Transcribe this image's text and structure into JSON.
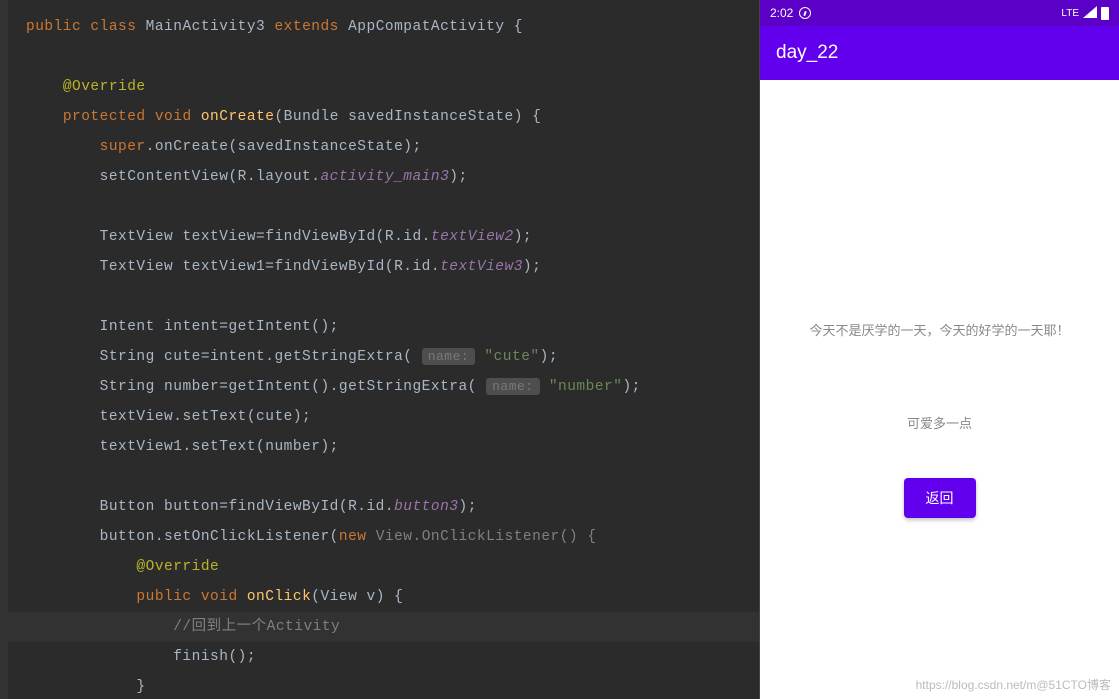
{
  "code": {
    "class_decl": {
      "public": "public",
      "class": "class",
      "name": "MainActivity3",
      "extends": "extends",
      "superclass": "AppCompatActivity",
      "open": "{"
    },
    "override1": "@Override",
    "onCreate": {
      "protected": "protected",
      "void": "void",
      "name": "onCreate",
      "params": "(Bundle savedInstanceState) {"
    },
    "superCall": {
      "super": "super",
      "rest": ".onCreate(savedInstanceState);"
    },
    "setContent": {
      "call": "setContentView(R.layout.",
      "res": "activity_main3",
      "end": ");"
    },
    "tv_decl1": {
      "type": "TextView textView=findViewById(R.id.",
      "id": "textView2",
      "end": ");"
    },
    "tv_decl2": {
      "type": "TextView textView1=findViewById(R.id.",
      "id": "textView3",
      "end": ");"
    },
    "intent": "Intent intent=getIntent();",
    "cute": {
      "pre": "String cute=intent.getStringExtra(",
      "hint": "name:",
      "str": "\"cute\"",
      "end": ");"
    },
    "number": {
      "pre": "String number=getIntent().getStringExtra(",
      "hint": "name:",
      "str": "\"number\"",
      "end": ");"
    },
    "setText1": "textView.setText(cute);",
    "setText2": "textView1.setText(number);",
    "btn_decl": {
      "pre": "Button button=findViewById(R.id.",
      "id": "button3",
      "end": ");"
    },
    "listener": {
      "pre": "button.setOnClickListener(",
      "new": "new",
      "cls": "View.OnClickListener() {",
      "mid": " "
    },
    "override2": "@Override",
    "onClick": {
      "public": "public",
      "void": "void",
      "name": "onClick",
      "params": "(View v) {"
    },
    "comment": "//回到上一个Activity",
    "finish": "finish();",
    "close1": "}"
  },
  "phone": {
    "status": {
      "time": "2:02",
      "lte": "LTE"
    },
    "app_title": "day_22",
    "text1": "今天不是厌学的一天，今天的好学的一天耶！",
    "text2": "可爱多一点",
    "button": "返回",
    "watermark": "https://blog.csdn.net/m@51CTO博客"
  }
}
